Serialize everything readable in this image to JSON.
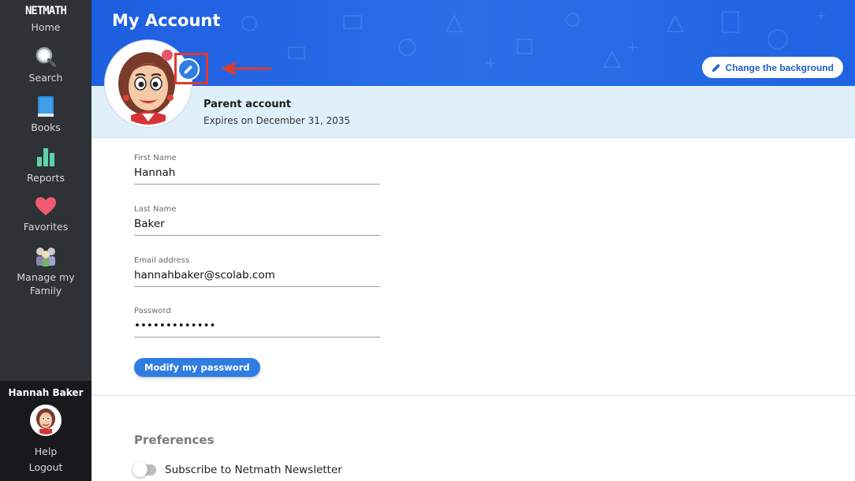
{
  "sidebar": {
    "logo": "NETMATH",
    "items": [
      {
        "label": "Home",
        "icon": "home-logo"
      },
      {
        "label": "Search",
        "icon": "magnifier-icon"
      },
      {
        "label": "Books",
        "icon": "book-icon"
      },
      {
        "label": "Reports",
        "icon": "bar-chart-icon"
      },
      {
        "label": "Favorites",
        "icon": "heart-icon"
      },
      {
        "label": "Manage my Family",
        "icon": "family-icon"
      }
    ],
    "user_name": "Hannah Baker",
    "help": "Help",
    "logout": "Logout"
  },
  "header": {
    "title": "My Account",
    "change_background": "Change the background"
  },
  "account": {
    "type": "Parent account",
    "expiry": "Expires on December 31, 2035"
  },
  "form": {
    "first_name_label": "First Name",
    "first_name": "Hannah",
    "last_name_label": "Last Name",
    "last_name": "Baker",
    "email_label": "Email address",
    "email": "hannahbaker@scolab.com",
    "password_label": "Password",
    "password": "•••••••••••••",
    "modify_password": "Modify my password"
  },
  "preferences": {
    "title": "Preferences",
    "newsletter": "Subscribe to Netmath Newsletter",
    "newsletter_enabled": false
  },
  "colors": {
    "sidebar": "#2e3136",
    "banner": "#2a6ee8",
    "accent": "#2f7de1",
    "strip": "#dff0fb",
    "highlight": "#e03a2f"
  }
}
